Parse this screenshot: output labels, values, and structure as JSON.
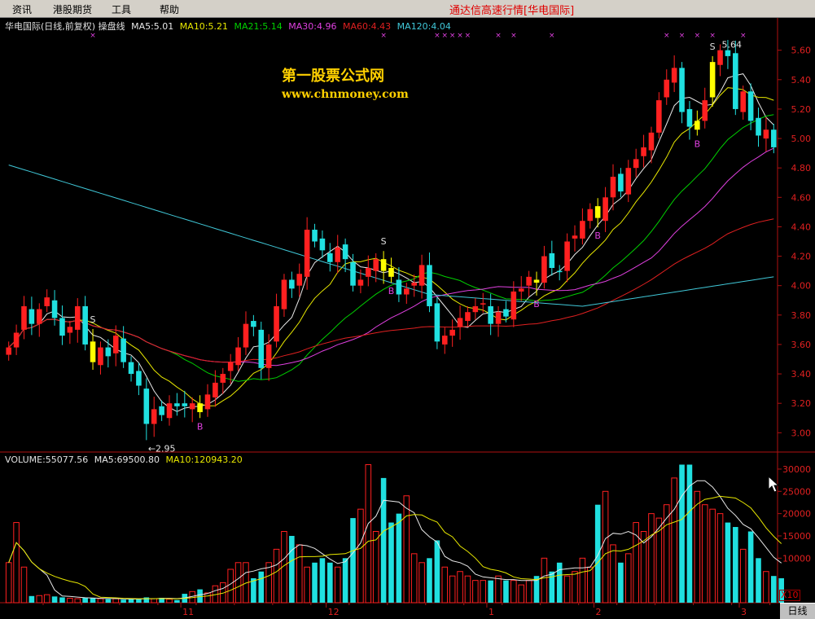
{
  "menu": {
    "items": [
      "资讯",
      "港股期货",
      "工具",
      "帮助"
    ],
    "title": "通达信高速行情[华电国际]"
  },
  "legend_top": {
    "prefix": "华电国际(日线,前复权) 操盘线",
    "ma5": "MA5:5.01",
    "ma10": "MA10:5.21",
    "ma21": "MA21:5.14",
    "ma30": "MA30:4.96",
    "ma60": "MA60:4.43",
    "ma120": "MA120:4.04"
  },
  "legend_vol": {
    "volume": "VOLUME:55077.56",
    "ma5": "MA5:69500.80",
    "ma10": "MA10:120943.20"
  },
  "watermark": {
    "line1": "第一股票公式网",
    "line2": "www.chnmoney.com"
  },
  "timeframe_label": "日线",
  "x10_label": "X10",
  "colors": {
    "up": "#ff2020",
    "down": "#20e0e0",
    "signal": "#ffff00",
    "ma5": "#e8e8e8",
    "ma10": "#e8e800",
    "ma21": "#00d000",
    "ma30": "#e040e0",
    "ma60": "#e02020",
    "ma120": "#40c8d8",
    "axis": "#b01010",
    "marker_x": "#e040e0",
    "buy": "#e040e0"
  },
  "chart_data": [
    {
      "type": "candlestick",
      "title": "华电国际(日线,前复权) 操盘线",
      "y_ticks": [
        3.0,
        3.2,
        3.4,
        3.6,
        3.8,
        4.0,
        4.2,
        4.4,
        4.6,
        4.8,
        5.0,
        5.2,
        5.4,
        5.6
      ],
      "ylim": [
        2.88,
        5.72
      ],
      "x_tick_labels": [
        "11",
        "12",
        "1",
        "2",
        "3"
      ],
      "x_tick_index": [
        23,
        42,
        63,
        77,
        96
      ],
      "closes": [
        3.58,
        3.68,
        3.86,
        3.74,
        3.84,
        3.92,
        3.78,
        3.66,
        3.72,
        3.86,
        3.6,
        3.48,
        3.58,
        3.52,
        3.66,
        3.48,
        3.4,
        3.32,
        3.06,
        3.16,
        3.12,
        3.2,
        3.18,
        3.18,
        3.2,
        3.14,
        3.26,
        3.34,
        3.4,
        3.48,
        3.58,
        3.74,
        3.72,
        3.44,
        3.6,
        3.86,
        4.04,
        3.98,
        4.08,
        4.38,
        4.3,
        4.24,
        4.16,
        4.26,
        4.18,
        4.0,
        4.04,
        4.12,
        4.18,
        4.1,
        4.06,
        3.94,
        3.98,
        4.02,
        4.14,
        3.86,
        3.62,
        3.66,
        3.7,
        3.78,
        3.82,
        3.86,
        3.88,
        3.74,
        3.82,
        3.79,
        3.96,
        3.98,
        4.06,
        4.02,
        4.2,
        4.12,
        4.1,
        4.3,
        4.34,
        4.44,
        4.52,
        4.46,
        4.6,
        4.74,
        4.64,
        4.8,
        4.86,
        4.94,
        5.04,
        5.26,
        5.4,
        5.48,
        5.18,
        5.08,
        5.12,
        5.26,
        5.52,
        5.6,
        5.56,
        5.2,
        5.32,
        5.12,
        5.02,
        5.06,
        4.94
      ],
      "swing_labels": [
        {
          "text": "2.95",
          "value": 2.95,
          "index": 18
        },
        {
          "text": "5.64",
          "value": 5.64,
          "index": 93
        }
      ],
      "signals": [
        {
          "text": "S",
          "index": 11
        },
        {
          "text": "S",
          "index": 49
        },
        {
          "text": "S",
          "index": 92
        },
        {
          "text": "B",
          "index": 25
        },
        {
          "text": "B",
          "index": 50
        },
        {
          "text": "B",
          "index": 69
        },
        {
          "text": "B",
          "index": 77
        },
        {
          "text": "B",
          "index": 90
        }
      ],
      "series_lines": [
        "MA5",
        "MA10",
        "MA21",
        "MA30",
        "MA60",
        "MA120"
      ]
    },
    {
      "type": "bar",
      "title": "VOLUME",
      "y_ticks": [
        10000,
        15000,
        20000,
        25000,
        30000
      ],
      "ylim": [
        0,
        32000
      ],
      "values": [
        9000,
        18000,
        8000,
        1500,
        1600,
        1800,
        1400,
        1200,
        1000,
        900,
        1100,
        1000,
        900,
        800,
        900,
        700,
        800,
        900,
        1200,
        900,
        1100,
        800,
        600,
        2000,
        2500,
        3000,
        2200,
        3800,
        4500,
        7500,
        9000,
        9000,
        5500,
        7000,
        9000,
        12000,
        16000,
        15000,
        13000,
        8000,
        9000,
        10000,
        9000,
        8000,
        10000,
        19000,
        21000,
        31000,
        16000,
        28000,
        18000,
        20000,
        24000,
        11000,
        9000,
        10000,
        14000,
        8000,
        6000,
        7000,
        6000,
        5000,
        5000,
        5000,
        6000,
        5000,
        5000,
        4000,
        5000,
        6000,
        10000,
        7000,
        9000,
        6000,
        7000,
        10000,
        8000,
        22000,
        25000,
        13000,
        9000,
        11000,
        18000,
        16000,
        20000,
        19000,
        22000,
        28000,
        31000,
        31000,
        25000,
        22000,
        21000,
        20000,
        18000,
        17000,
        12000,
        16000,
        10000,
        7000,
        6000,
        5500
      ],
      "volume_up_down": "bars follow candle colour"
    }
  ]
}
